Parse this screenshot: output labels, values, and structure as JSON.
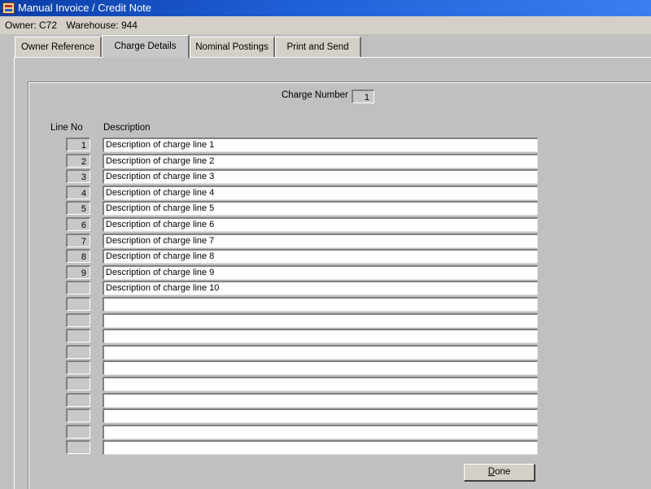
{
  "window": {
    "title": "Manual Invoice / Credit Note"
  },
  "owner_bar": {
    "owner": "Owner: C72",
    "warehouse": "Warehouse: 944"
  },
  "tabs": [
    {
      "label": "Owner Reference"
    },
    {
      "label": "Charge Details"
    },
    {
      "label": "Nominal Postings"
    },
    {
      "label": "Print and Send"
    }
  ],
  "active_tab": "Charge Details",
  "charge": {
    "label": "Charge Number",
    "value": "1"
  },
  "columns": {
    "line_no": "Line No",
    "description": "Description"
  },
  "lines": [
    {
      "no": "1",
      "description": "Description of charge line 1"
    },
    {
      "no": "2",
      "description": "Description of charge line 2"
    },
    {
      "no": "3",
      "description": "Description of charge line 3"
    },
    {
      "no": "4",
      "description": "Description of charge line 4"
    },
    {
      "no": "5",
      "description": "Description of charge line 5"
    },
    {
      "no": "6",
      "description": "Description of charge line 6"
    },
    {
      "no": "7",
      "description": "Description of charge line 7"
    },
    {
      "no": "8",
      "description": "Description of charge line 8"
    },
    {
      "no": "9",
      "description": "Description of charge line 9"
    },
    {
      "no": "",
      "description": "Description of charge line 10"
    },
    {
      "no": "",
      "description": ""
    },
    {
      "no": "",
      "description": ""
    },
    {
      "no": "",
      "description": ""
    },
    {
      "no": "",
      "description": ""
    },
    {
      "no": "",
      "description": ""
    },
    {
      "no": "",
      "description": ""
    },
    {
      "no": "",
      "description": ""
    },
    {
      "no": "",
      "description": ""
    },
    {
      "no": "",
      "description": ""
    },
    {
      "no": "",
      "description": ""
    }
  ],
  "buttons": {
    "done_first": "D",
    "done_rest": "one"
  },
  "icons": {
    "app": "oracle-forms-app-icon"
  }
}
